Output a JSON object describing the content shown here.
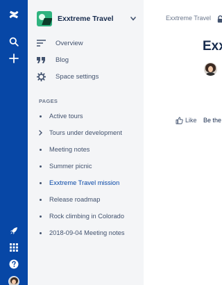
{
  "colors": {
    "rail": "#0747a6",
    "sidebar": "#f4f5f7",
    "space_avatar": "#2fb37f",
    "active_link": "#0747a6"
  },
  "global_nav": {
    "top_icons": [
      "confluence-logo-icon",
      "search-icon",
      "create-plus-icon"
    ],
    "bottom_icons": [
      "rocket-icon",
      "app-switcher-icon",
      "help-icon",
      "user-avatar"
    ]
  },
  "sidebar": {
    "space_name": "Exxtreme Travel",
    "nav_items": [
      {
        "label": "Overview",
        "icon": "overview-lines-icon"
      },
      {
        "label": "Blog",
        "icon": "quote-icon"
      },
      {
        "label": "Space settings",
        "icon": "gear-icon"
      }
    ],
    "pages_heading": "PAGES",
    "pages": [
      {
        "label": "Active tours",
        "marker": "bullet"
      },
      {
        "label": "Tours under development",
        "marker": "chevron"
      },
      {
        "label": "Meeting notes",
        "marker": "bullet"
      },
      {
        "label": "Summer picnic",
        "marker": "bullet"
      },
      {
        "label": "Exxtreme Travel mission",
        "marker": "bullet",
        "active": true
      },
      {
        "label": "Release roadmap",
        "marker": "bullet"
      },
      {
        "label": "Rock climbing in Colorado",
        "marker": "bullet"
      },
      {
        "label": "2018-09-04 Meeting notes",
        "marker": "bullet"
      }
    ]
  },
  "main": {
    "breadcrumb_space": "Exxtreme Travel",
    "title": "Exxt",
    "like_label": "Like",
    "be_first_text": "Be the"
  }
}
